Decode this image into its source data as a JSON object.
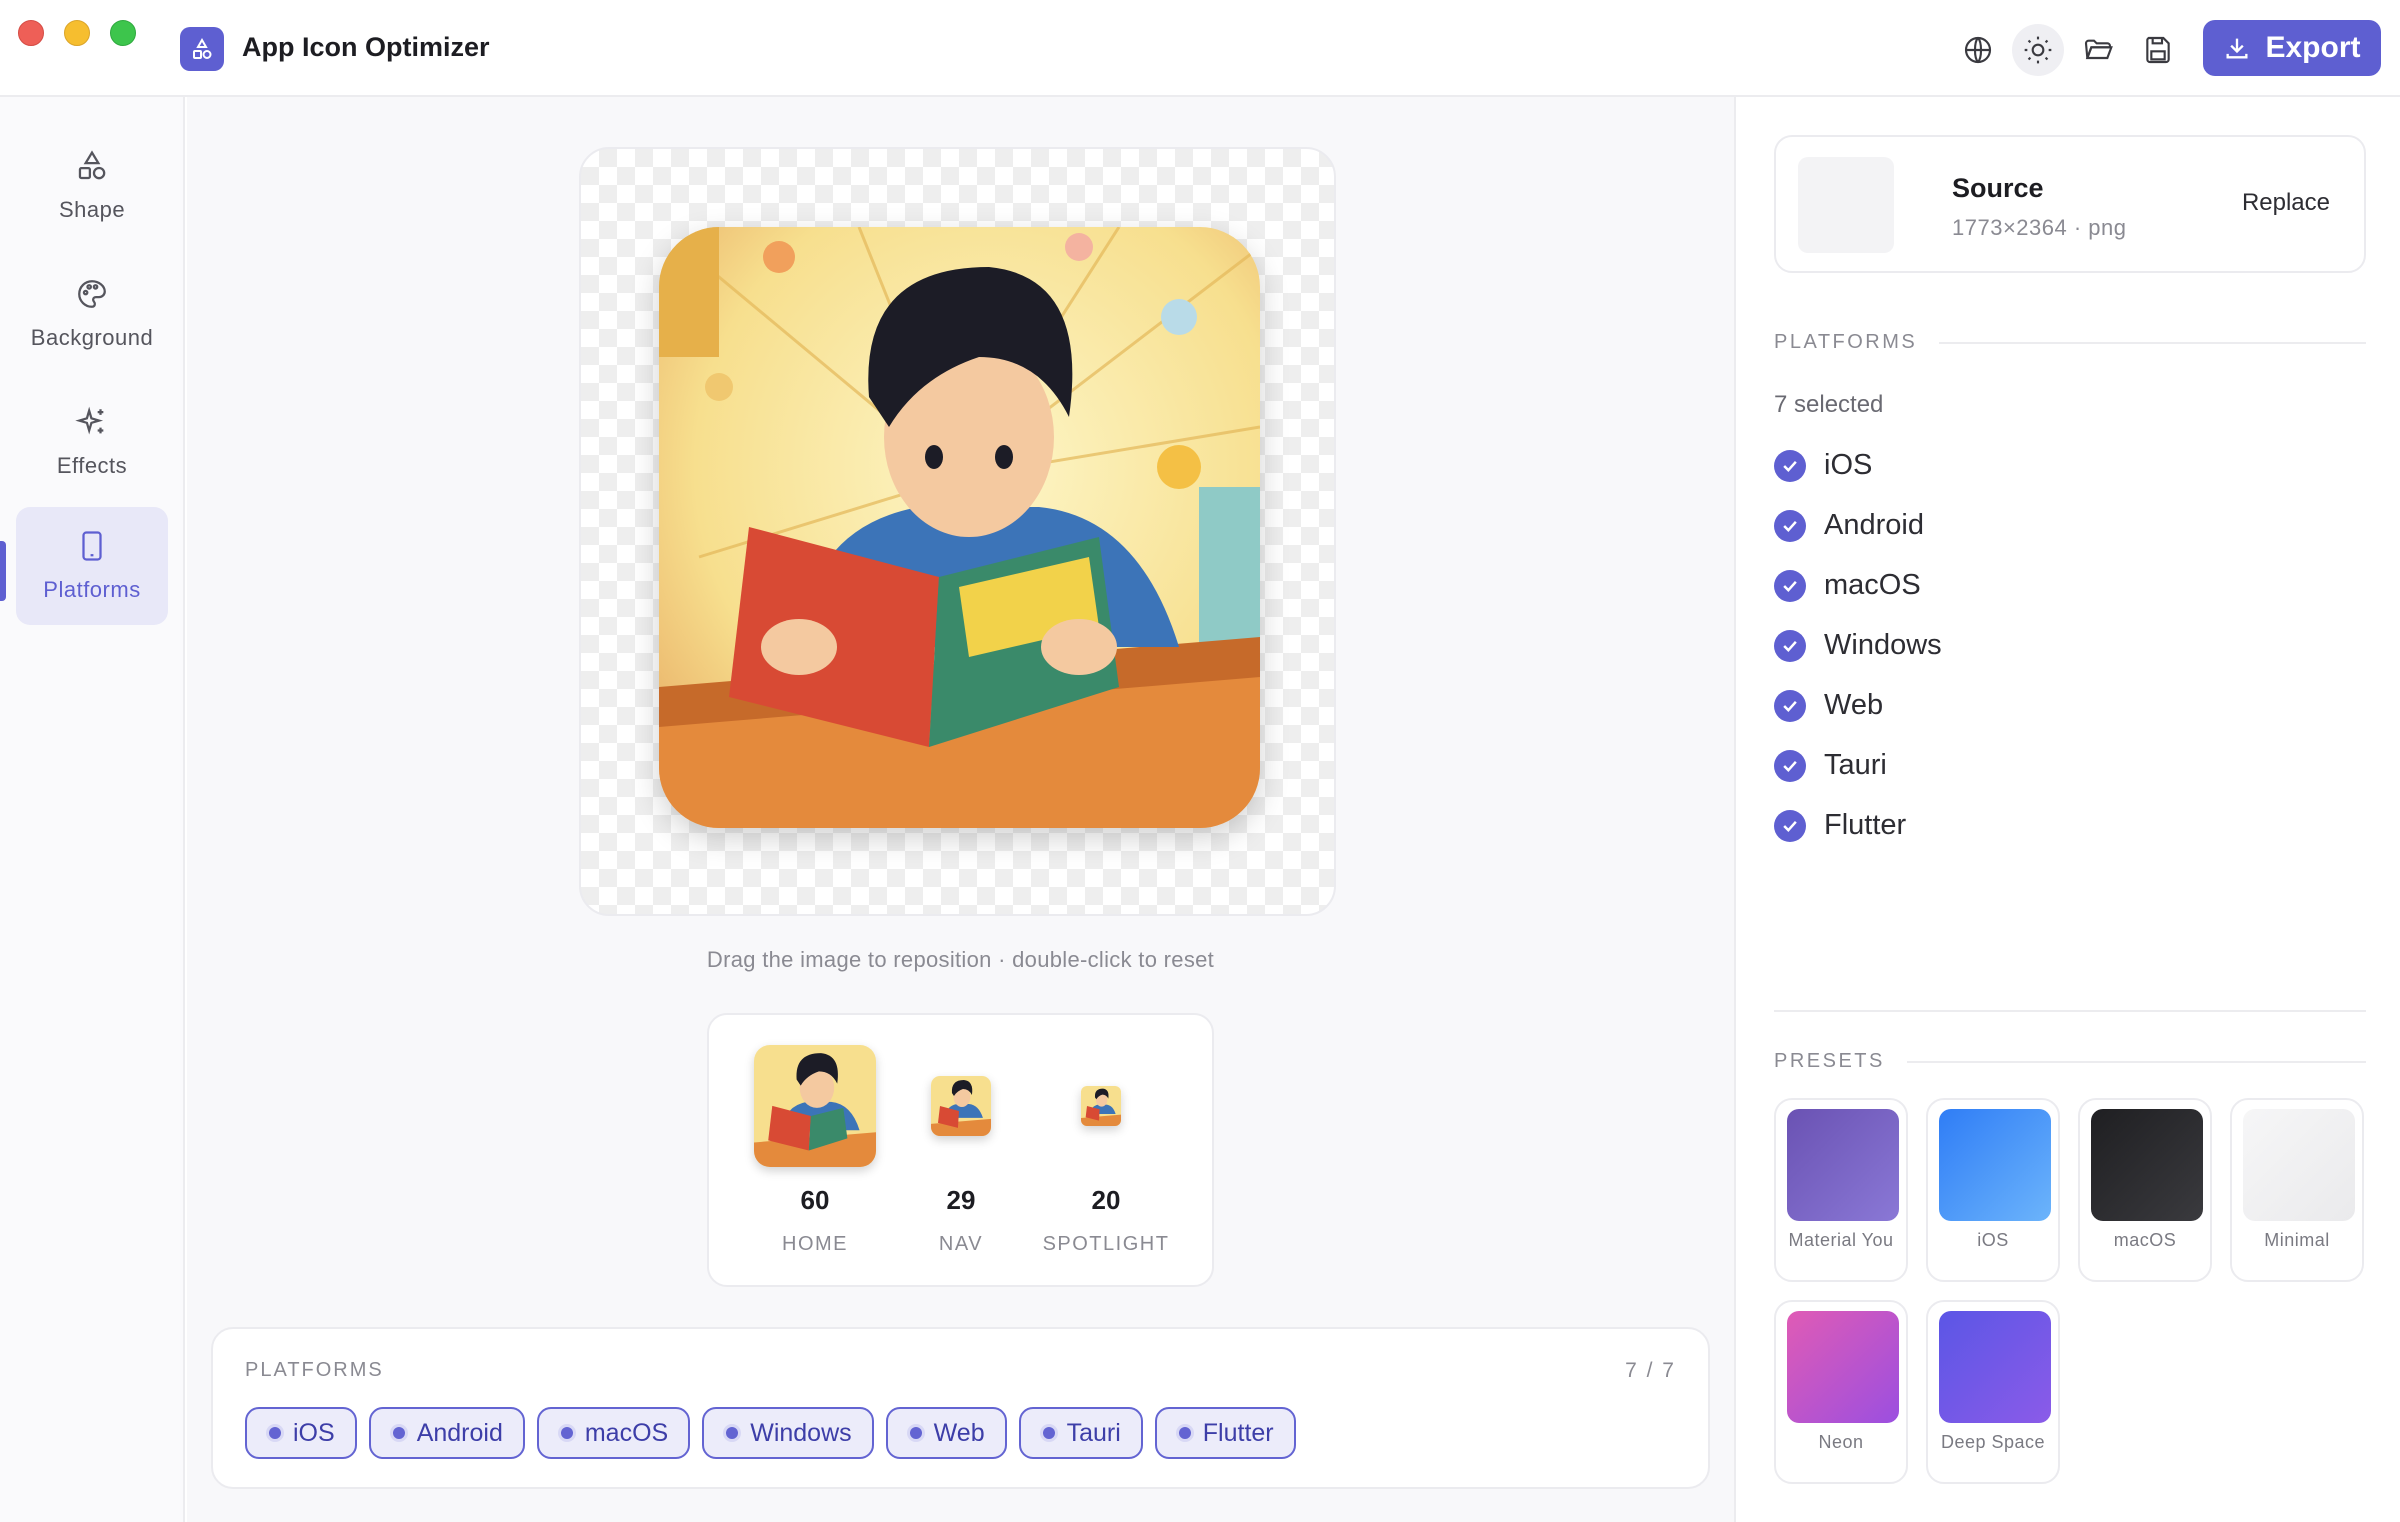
{
  "app": {
    "title": "App Icon Optimizer"
  },
  "toolbar": {
    "icons": [
      "globe-icon",
      "sun-icon",
      "folder-icon",
      "save-icon"
    ],
    "export_label": "Export"
  },
  "rail": {
    "items": [
      {
        "label": "Shape",
        "icon": "shapes-icon"
      },
      {
        "label": "Background",
        "icon": "palette-icon"
      },
      {
        "label": "Effects",
        "icon": "sparkles-icon"
      },
      {
        "label": "Platforms",
        "icon": "phone-icon"
      }
    ],
    "active": "Platforms"
  },
  "canvas": {
    "hint": "Drag the image to reposition · double-click to reset",
    "sizes": [
      {
        "size": "60",
        "label": "HOME"
      },
      {
        "size": "29",
        "label": "NAV"
      },
      {
        "size": "20",
        "label": "SPOTLIGHT"
      }
    ]
  },
  "platform_card": {
    "title": "PLATFORMS",
    "count": "7 / 7",
    "chips": [
      "iOS",
      "Android",
      "macOS",
      "Windows",
      "Web",
      "Tauri",
      "Flutter"
    ]
  },
  "source": {
    "title": "Source",
    "meta": "1773×2364 · png",
    "replace_label": "Replace"
  },
  "platforms": {
    "heading": "PLATFORMS",
    "selected": "7 selected",
    "items": [
      "iOS",
      "Android",
      "macOS",
      "Windows",
      "Web",
      "Tauri",
      "Flutter"
    ]
  },
  "presets": {
    "heading": "PRESETS",
    "items": [
      {
        "label": "Material You",
        "color1": "#6a52b3",
        "color2": "#8a78d6"
      },
      {
        "label": "iOS",
        "color1": "#2f7df6",
        "color2": "#6cb4fb"
      },
      {
        "label": "macOS",
        "color1": "#1f1f22",
        "color2": "#3a3a3e"
      },
      {
        "label": "Minimal",
        "color1": "#f6f6f7",
        "color2": "#eaeaec"
      },
      {
        "label": "Neon",
        "color1": "#e05bb5",
        "color2": "#9b4fe0"
      },
      {
        "label": "Deep Space",
        "color1": "#5b56e6",
        "color2": "#8b5be8"
      }
    ]
  }
}
